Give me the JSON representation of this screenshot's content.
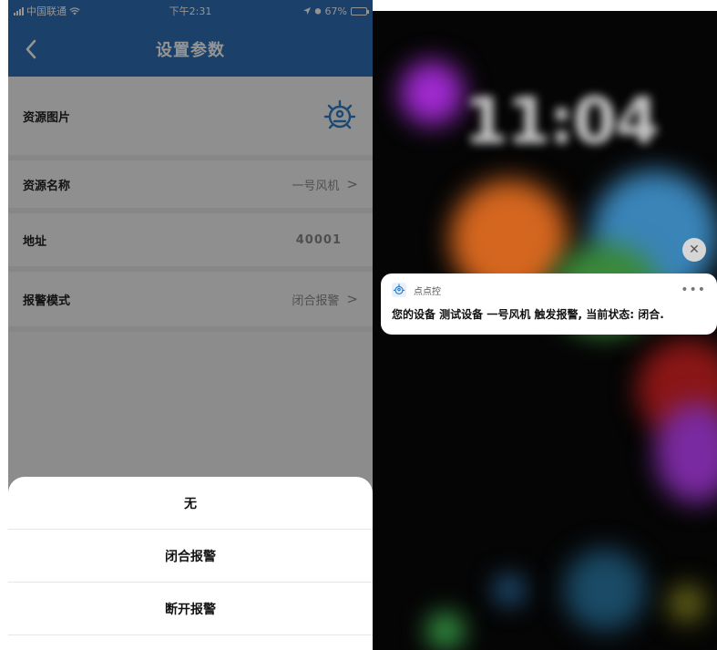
{
  "left_screen": {
    "status_bar": {
      "carrier": "中国联通",
      "time": "下午2:31",
      "battery_percent": "67%",
      "battery_level": 0.67
    },
    "nav": {
      "title": "设置参数",
      "back_icon": "chevron-left-icon"
    },
    "settings": {
      "resource_image_label": "资源图片",
      "resource_name_label": "资源名称",
      "resource_name_value": "一号风机",
      "address_label": "地址",
      "address_value": "40001",
      "alarm_mode_label": "报警模式",
      "alarm_mode_value": "闭合报警"
    },
    "action_sheet": {
      "options": [
        "无",
        "闭合报警",
        "断开报警"
      ]
    },
    "colors": {
      "header": "#2f6fb5"
    }
  },
  "right_screen": {
    "lock_time": "11:04",
    "notification": {
      "app_name": "点点控",
      "more_icon": "ellipsis-icon",
      "close_icon": "close-icon",
      "message": "您的设备 测试设备 一号风机 触发报警, 当前状态: 闭合."
    }
  }
}
